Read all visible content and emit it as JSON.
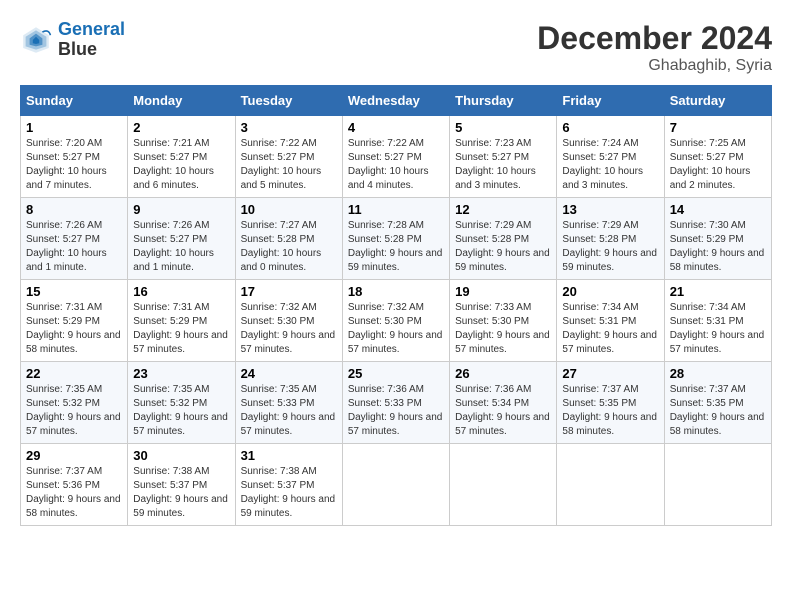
{
  "header": {
    "logo_line1": "General",
    "logo_line2": "Blue",
    "month": "December 2024",
    "location": "Ghabaghib, Syria"
  },
  "columns": [
    "Sunday",
    "Monday",
    "Tuesday",
    "Wednesday",
    "Thursday",
    "Friday",
    "Saturday"
  ],
  "weeks": [
    [
      {
        "day": "1",
        "sunrise": "Sunrise: 7:20 AM",
        "sunset": "Sunset: 5:27 PM",
        "daylight": "Daylight: 10 hours and 7 minutes."
      },
      {
        "day": "2",
        "sunrise": "Sunrise: 7:21 AM",
        "sunset": "Sunset: 5:27 PM",
        "daylight": "Daylight: 10 hours and 6 minutes."
      },
      {
        "day": "3",
        "sunrise": "Sunrise: 7:22 AM",
        "sunset": "Sunset: 5:27 PM",
        "daylight": "Daylight: 10 hours and 5 minutes."
      },
      {
        "day": "4",
        "sunrise": "Sunrise: 7:22 AM",
        "sunset": "Sunset: 5:27 PM",
        "daylight": "Daylight: 10 hours and 4 minutes."
      },
      {
        "day": "5",
        "sunrise": "Sunrise: 7:23 AM",
        "sunset": "Sunset: 5:27 PM",
        "daylight": "Daylight: 10 hours and 3 minutes."
      },
      {
        "day": "6",
        "sunrise": "Sunrise: 7:24 AM",
        "sunset": "Sunset: 5:27 PM",
        "daylight": "Daylight: 10 hours and 3 minutes."
      },
      {
        "day": "7",
        "sunrise": "Sunrise: 7:25 AM",
        "sunset": "Sunset: 5:27 PM",
        "daylight": "Daylight: 10 hours and 2 minutes."
      }
    ],
    [
      {
        "day": "8",
        "sunrise": "Sunrise: 7:26 AM",
        "sunset": "Sunset: 5:27 PM",
        "daylight": "Daylight: 10 hours and 1 minute."
      },
      {
        "day": "9",
        "sunrise": "Sunrise: 7:26 AM",
        "sunset": "Sunset: 5:27 PM",
        "daylight": "Daylight: 10 hours and 1 minute."
      },
      {
        "day": "10",
        "sunrise": "Sunrise: 7:27 AM",
        "sunset": "Sunset: 5:28 PM",
        "daylight": "Daylight: 10 hours and 0 minutes."
      },
      {
        "day": "11",
        "sunrise": "Sunrise: 7:28 AM",
        "sunset": "Sunset: 5:28 PM",
        "daylight": "Daylight: 9 hours and 59 minutes."
      },
      {
        "day": "12",
        "sunrise": "Sunrise: 7:29 AM",
        "sunset": "Sunset: 5:28 PM",
        "daylight": "Daylight: 9 hours and 59 minutes."
      },
      {
        "day": "13",
        "sunrise": "Sunrise: 7:29 AM",
        "sunset": "Sunset: 5:28 PM",
        "daylight": "Daylight: 9 hours and 59 minutes."
      },
      {
        "day": "14",
        "sunrise": "Sunrise: 7:30 AM",
        "sunset": "Sunset: 5:29 PM",
        "daylight": "Daylight: 9 hours and 58 minutes."
      }
    ],
    [
      {
        "day": "15",
        "sunrise": "Sunrise: 7:31 AM",
        "sunset": "Sunset: 5:29 PM",
        "daylight": "Daylight: 9 hours and 58 minutes."
      },
      {
        "day": "16",
        "sunrise": "Sunrise: 7:31 AM",
        "sunset": "Sunset: 5:29 PM",
        "daylight": "Daylight: 9 hours and 57 minutes."
      },
      {
        "day": "17",
        "sunrise": "Sunrise: 7:32 AM",
        "sunset": "Sunset: 5:30 PM",
        "daylight": "Daylight: 9 hours and 57 minutes."
      },
      {
        "day": "18",
        "sunrise": "Sunrise: 7:32 AM",
        "sunset": "Sunset: 5:30 PM",
        "daylight": "Daylight: 9 hours and 57 minutes."
      },
      {
        "day": "19",
        "sunrise": "Sunrise: 7:33 AM",
        "sunset": "Sunset: 5:30 PM",
        "daylight": "Daylight: 9 hours and 57 minutes."
      },
      {
        "day": "20",
        "sunrise": "Sunrise: 7:34 AM",
        "sunset": "Sunset: 5:31 PM",
        "daylight": "Daylight: 9 hours and 57 minutes."
      },
      {
        "day": "21",
        "sunrise": "Sunrise: 7:34 AM",
        "sunset": "Sunset: 5:31 PM",
        "daylight": "Daylight: 9 hours and 57 minutes."
      }
    ],
    [
      {
        "day": "22",
        "sunrise": "Sunrise: 7:35 AM",
        "sunset": "Sunset: 5:32 PM",
        "daylight": "Daylight: 9 hours and 57 minutes."
      },
      {
        "day": "23",
        "sunrise": "Sunrise: 7:35 AM",
        "sunset": "Sunset: 5:32 PM",
        "daylight": "Daylight: 9 hours and 57 minutes."
      },
      {
        "day": "24",
        "sunrise": "Sunrise: 7:35 AM",
        "sunset": "Sunset: 5:33 PM",
        "daylight": "Daylight: 9 hours and 57 minutes."
      },
      {
        "day": "25",
        "sunrise": "Sunrise: 7:36 AM",
        "sunset": "Sunset: 5:33 PM",
        "daylight": "Daylight: 9 hours and 57 minutes."
      },
      {
        "day": "26",
        "sunrise": "Sunrise: 7:36 AM",
        "sunset": "Sunset: 5:34 PM",
        "daylight": "Daylight: 9 hours and 57 minutes."
      },
      {
        "day": "27",
        "sunrise": "Sunrise: 7:37 AM",
        "sunset": "Sunset: 5:35 PM",
        "daylight": "Daylight: 9 hours and 58 minutes."
      },
      {
        "day": "28",
        "sunrise": "Sunrise: 7:37 AM",
        "sunset": "Sunset: 5:35 PM",
        "daylight": "Daylight: 9 hours and 58 minutes."
      }
    ],
    [
      {
        "day": "29",
        "sunrise": "Sunrise: 7:37 AM",
        "sunset": "Sunset: 5:36 PM",
        "daylight": "Daylight: 9 hours and 58 minutes."
      },
      {
        "day": "30",
        "sunrise": "Sunrise: 7:38 AM",
        "sunset": "Sunset: 5:37 PM",
        "daylight": "Daylight: 9 hours and 59 minutes."
      },
      {
        "day": "31",
        "sunrise": "Sunrise: 7:38 AM",
        "sunset": "Sunset: 5:37 PM",
        "daylight": "Daylight: 9 hours and 59 minutes."
      },
      null,
      null,
      null,
      null
    ]
  ]
}
